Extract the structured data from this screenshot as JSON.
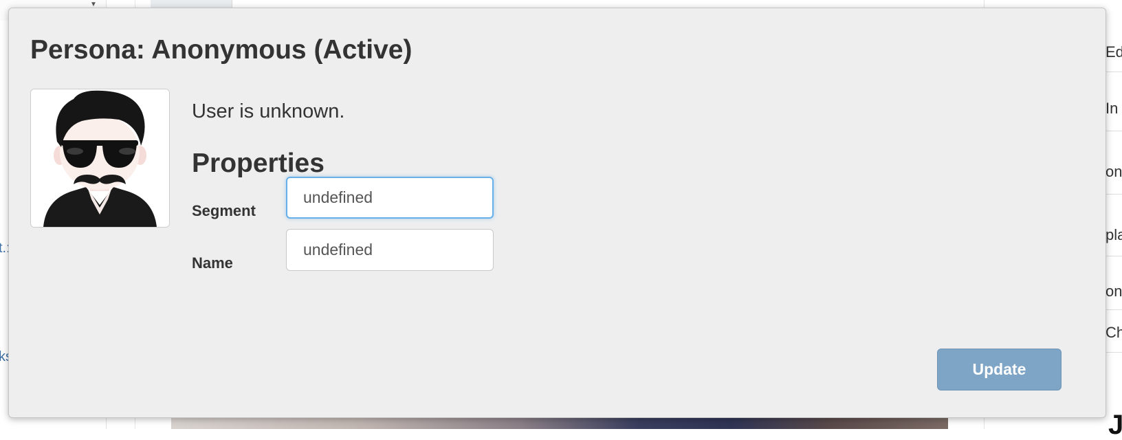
{
  "dialog": {
    "title": "Persona: Anonymous (Active)",
    "status_text": "User is unknown.",
    "properties_heading": "Properties",
    "fields": {
      "segment": {
        "label": "Segment",
        "value": "undefined"
      },
      "name": {
        "label": "Name",
        "value": "undefined"
      }
    },
    "update_button_label": "Update",
    "avatar_icon": "anonymous-persona-avatar"
  },
  "background": {
    "left_links": [
      "t.:",
      "ks"
    ],
    "right_items": [
      "Ed",
      "In",
      "on",
      "pla",
      "on",
      "Ch"
    ]
  },
  "colors": {
    "dialog_background": "#eeeeee",
    "focus_ring": "#66afe9",
    "update_button": "#7ea4c6",
    "text": "#333333"
  }
}
